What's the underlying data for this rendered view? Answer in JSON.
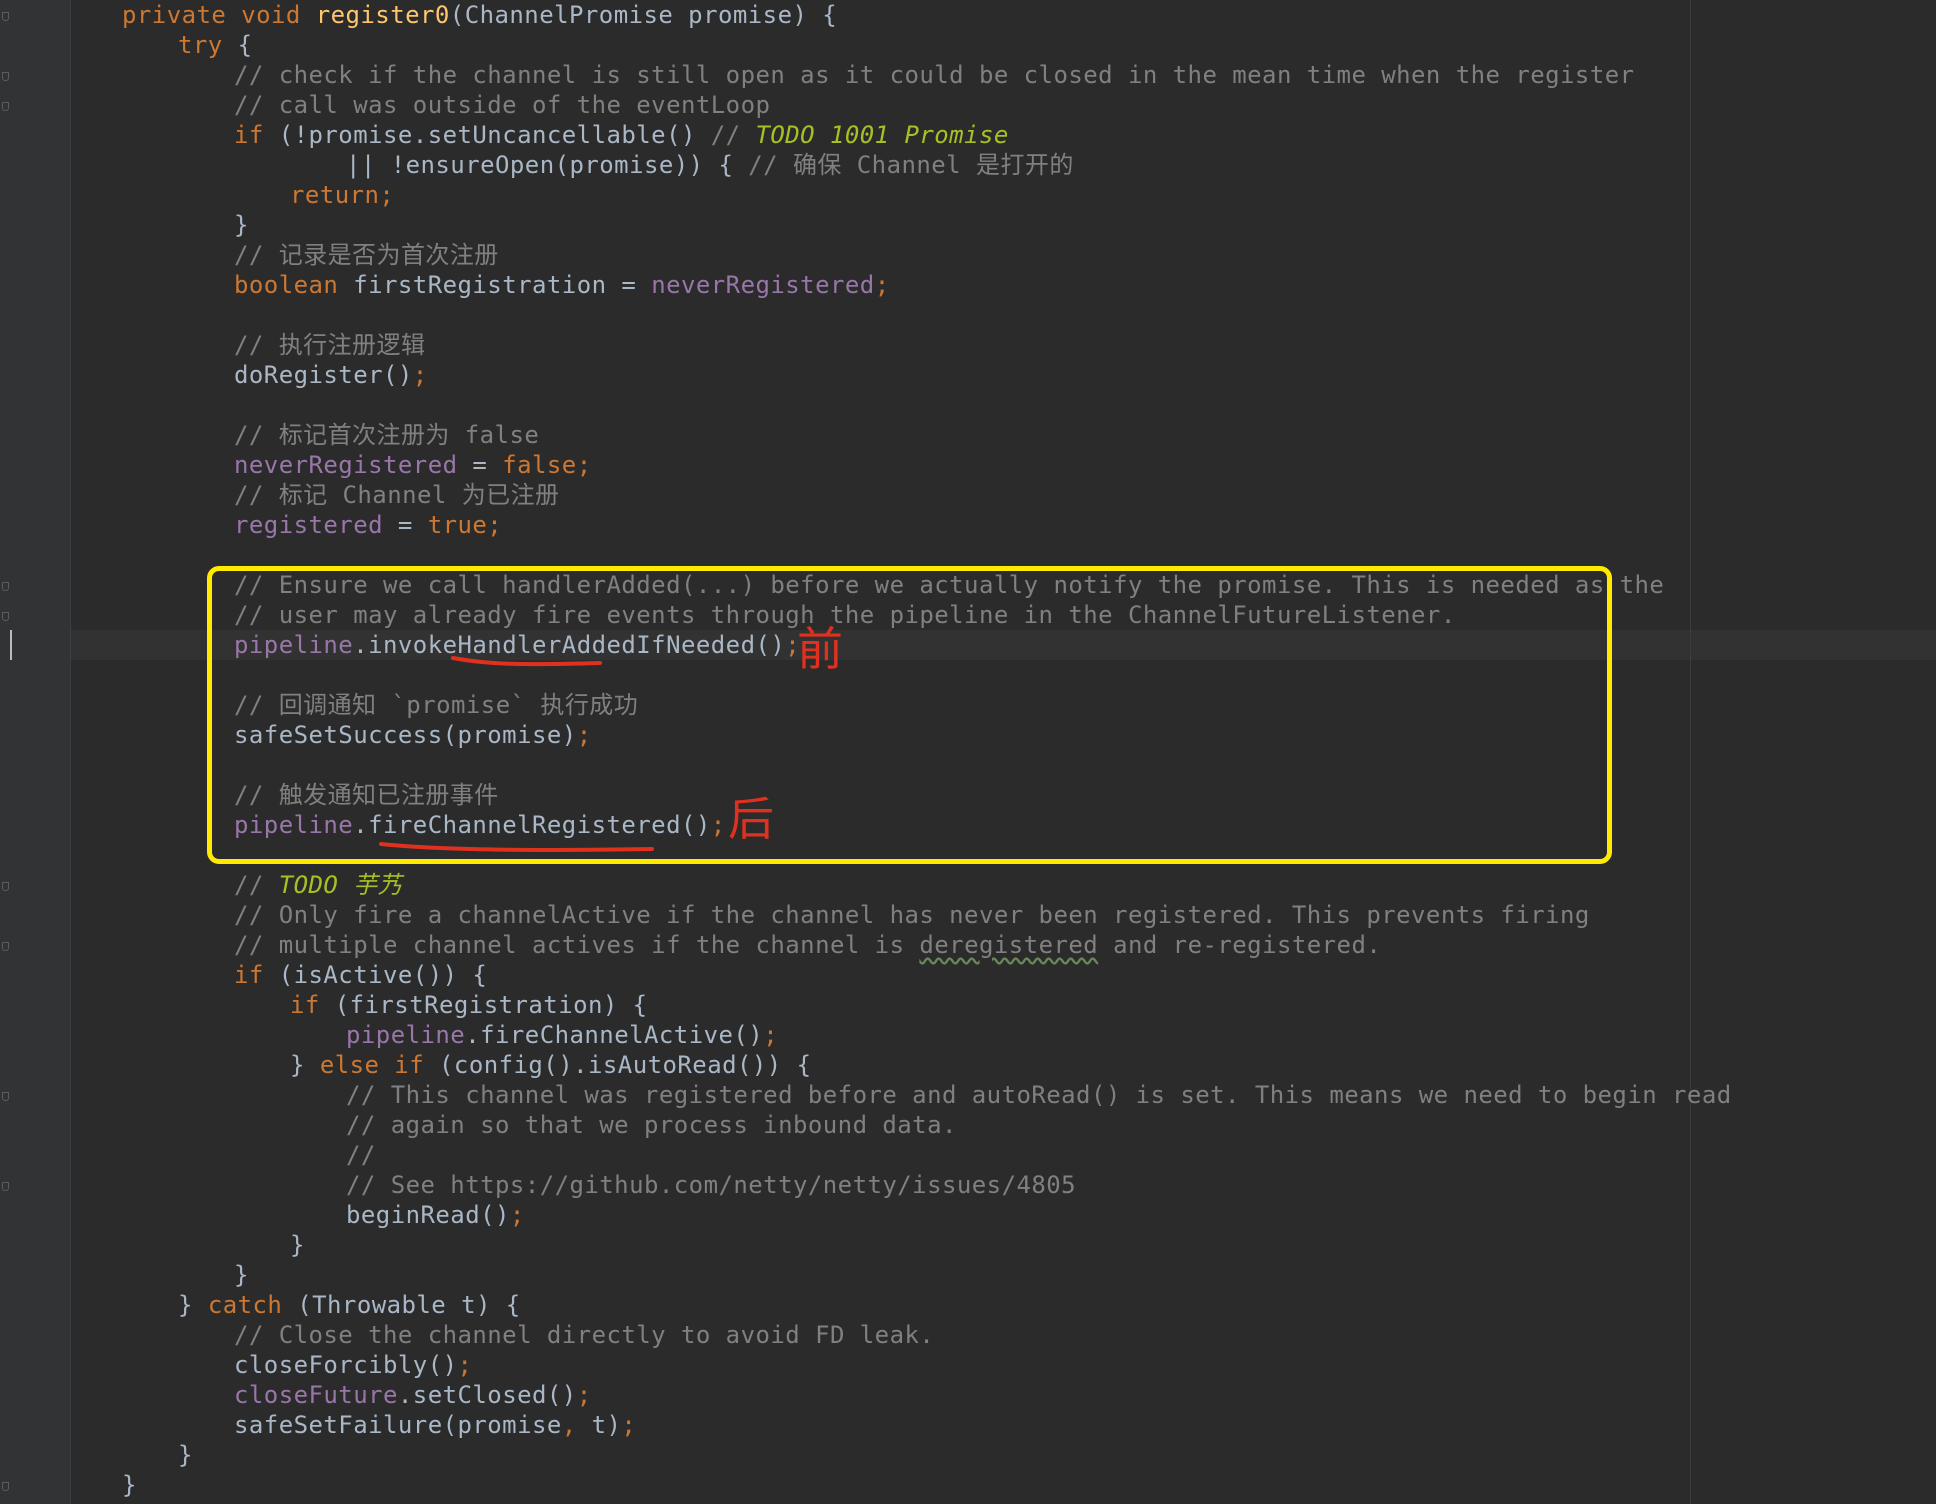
{
  "editor": {
    "colors": {
      "background": "#2b2b2b",
      "keyword": "#cc7832",
      "method_declaration": "#ffc66d",
      "field": "#9876aa",
      "comment": "#808080",
      "todo": "#a8c023",
      "plain": "#a9b7c6",
      "highlight_box": "#ffea00",
      "annotation_red": "#e0311f"
    },
    "lines": [
      {
        "n": 0,
        "indent": 1,
        "tokens": [
          {
            "t": "private ",
            "c": "kw"
          },
          {
            "t": "void ",
            "c": "kw"
          },
          {
            "t": "register0",
            "c": "fn"
          },
          {
            "t": "(ChannelPromise promise) {",
            "c": "pl"
          }
        ]
      },
      {
        "n": 1,
        "indent": 2,
        "tokens": [
          {
            "t": "try ",
            "c": "kw"
          },
          {
            "t": "{",
            "c": "pl"
          }
        ]
      },
      {
        "n": 2,
        "indent": 3,
        "tokens": [
          {
            "t": "// check if the channel is still open as it could be closed in the mean time when the register",
            "c": "cm"
          }
        ]
      },
      {
        "n": 3,
        "indent": 3,
        "tokens": [
          {
            "t": "// call was outside of the eventLoop",
            "c": "cm"
          }
        ]
      },
      {
        "n": 4,
        "indent": 3,
        "tokens": [
          {
            "t": "if ",
            "c": "kw"
          },
          {
            "t": "(!promise.setUncancellable() ",
            "c": "pl"
          },
          {
            "t": "// ",
            "c": "cm"
          },
          {
            "t": "TODO 1001 Promise",
            "c": "todo"
          }
        ]
      },
      {
        "n": 5,
        "indent": 5,
        "tokens": [
          {
            "t": "|| !ensureOpen(promise)) { ",
            "c": "pl"
          },
          {
            "t": "// 确保 Channel 是打开的",
            "c": "cm"
          }
        ]
      },
      {
        "n": 6,
        "indent": 4,
        "tokens": [
          {
            "t": "return;",
            "c": "kw"
          }
        ]
      },
      {
        "n": 7,
        "indent": 3,
        "tokens": [
          {
            "t": "}",
            "c": "pl"
          }
        ]
      },
      {
        "n": 8,
        "indent": 3,
        "tokens": [
          {
            "t": "// 记录是否为首次注册",
            "c": "cm"
          }
        ]
      },
      {
        "n": 9,
        "indent": 3,
        "tokens": [
          {
            "t": "boolean ",
            "c": "kw"
          },
          {
            "t": "firstRegistration = ",
            "c": "pl"
          },
          {
            "t": "neverRegistered",
            "c": "fld"
          },
          {
            "t": ";",
            "c": "kw"
          }
        ]
      },
      {
        "n": 11,
        "indent": 3,
        "tokens": [
          {
            "t": "// 执行注册逻辑",
            "c": "cm"
          }
        ]
      },
      {
        "n": 12,
        "indent": 3,
        "tokens": [
          {
            "t": "doRegister()",
            "c": "pl"
          },
          {
            "t": ";",
            "c": "kw"
          }
        ]
      },
      {
        "n": 14,
        "indent": 3,
        "tokens": [
          {
            "t": "// 标记首次注册为 false",
            "c": "cm"
          }
        ]
      },
      {
        "n": 15,
        "indent": 3,
        "tokens": [
          {
            "t": "neverRegistered",
            "c": "fld"
          },
          {
            "t": " = ",
            "c": "pl"
          },
          {
            "t": "false;",
            "c": "kw"
          }
        ]
      },
      {
        "n": 16,
        "indent": 3,
        "tokens": [
          {
            "t": "// 标记 Channel 为已注册",
            "c": "cm"
          }
        ]
      },
      {
        "n": 17,
        "indent": 3,
        "tokens": [
          {
            "t": "registered",
            "c": "fld"
          },
          {
            "t": " = ",
            "c": "pl"
          },
          {
            "t": "true;",
            "c": "kw"
          }
        ]
      },
      {
        "n": 19,
        "indent": 3,
        "tokens": [
          {
            "t": "// Ensure we call handlerAdded(...) before we actually notify the promise. This is needed as the",
            "c": "cm"
          }
        ]
      },
      {
        "n": 20,
        "indent": 3,
        "tokens": [
          {
            "t": "// user may already fire events through the pipeline in the ChannelFutureListener.",
            "c": "cm"
          }
        ]
      },
      {
        "n": 21,
        "indent": 3,
        "tokens": [
          {
            "t": "pipeline",
            "c": "fld"
          },
          {
            "t": ".invokeHandlerAddedIfNeeded()",
            "c": "pl"
          },
          {
            "t": ";",
            "c": "kw"
          }
        ]
      },
      {
        "n": 23,
        "indent": 3,
        "tokens": [
          {
            "t": "// 回调通知 `promise` 执行成功",
            "c": "cm"
          }
        ]
      },
      {
        "n": 24,
        "indent": 3,
        "tokens": [
          {
            "t": "safeSetSuccess(promise)",
            "c": "pl"
          },
          {
            "t": ";",
            "c": "kw"
          }
        ]
      },
      {
        "n": 26,
        "indent": 3,
        "tokens": [
          {
            "t": "// 触发通知已注册事件",
            "c": "cm"
          }
        ]
      },
      {
        "n": 27,
        "indent": 3,
        "tokens": [
          {
            "t": "pipeline",
            "c": "fld"
          },
          {
            "t": ".fireChannelRegistered()",
            "c": "pl"
          },
          {
            "t": ";",
            "c": "kw"
          }
        ]
      },
      {
        "n": 29,
        "indent": 3,
        "tokens": [
          {
            "t": "// ",
            "c": "cm"
          },
          {
            "t": "TODO 芋艿",
            "c": "todo"
          }
        ]
      },
      {
        "n": 30,
        "indent": 3,
        "tokens": [
          {
            "t": "// Only fire a channelActive if the channel has never been registered. This prevents firing",
            "c": "cm"
          }
        ]
      },
      {
        "n": 31,
        "indent": 3,
        "tokens": [
          {
            "t": "// multiple channel actives if the channel is ",
            "c": "cm"
          },
          {
            "t": "deregistered",
            "c": "cm wavy"
          },
          {
            "t": " and re-registered.",
            "c": "cm"
          }
        ]
      },
      {
        "n": 32,
        "indent": 3,
        "tokens": [
          {
            "t": "if ",
            "c": "kw"
          },
          {
            "t": "(isActive()) {",
            "c": "pl"
          }
        ]
      },
      {
        "n": 33,
        "indent": 4,
        "tokens": [
          {
            "t": "if ",
            "c": "kw"
          },
          {
            "t": "(firstRegistration) {",
            "c": "pl"
          }
        ]
      },
      {
        "n": 34,
        "indent": 5,
        "tokens": [
          {
            "t": "pipeline",
            "c": "fld"
          },
          {
            "t": ".fireChannelActive()",
            "c": "pl"
          },
          {
            "t": ";",
            "c": "kw"
          }
        ]
      },
      {
        "n": 35,
        "indent": 4,
        "tokens": [
          {
            "t": "} ",
            "c": "pl"
          },
          {
            "t": "else if ",
            "c": "kw"
          },
          {
            "t": "(config().isAutoRead()) {",
            "c": "pl"
          }
        ]
      },
      {
        "n": 36,
        "indent": 5,
        "tokens": [
          {
            "t": "// This channel was registered before and autoRead() is set. This means we need to begin read",
            "c": "cm"
          }
        ]
      },
      {
        "n": 37,
        "indent": 5,
        "tokens": [
          {
            "t": "// again so that we process inbound data.",
            "c": "cm"
          }
        ]
      },
      {
        "n": 38,
        "indent": 5,
        "tokens": [
          {
            "t": "//",
            "c": "cm"
          }
        ]
      },
      {
        "n": 39,
        "indent": 5,
        "tokens": [
          {
            "t": "// See https://github.com/netty/netty/issues/4805",
            "c": "cm"
          }
        ]
      },
      {
        "n": 40,
        "indent": 5,
        "tokens": [
          {
            "t": "beginRead()",
            "c": "pl"
          },
          {
            "t": ";",
            "c": "kw"
          }
        ]
      },
      {
        "n": 41,
        "indent": 4,
        "tokens": [
          {
            "t": "}",
            "c": "pl"
          }
        ]
      },
      {
        "n": 42,
        "indent": 3,
        "tokens": [
          {
            "t": "}",
            "c": "pl"
          }
        ]
      },
      {
        "n": 43,
        "indent": 2,
        "tokens": [
          {
            "t": "} ",
            "c": "pl"
          },
          {
            "t": "catch ",
            "c": "kw"
          },
          {
            "t": "(Throwable t) {",
            "c": "pl"
          }
        ]
      },
      {
        "n": 44,
        "indent": 3,
        "tokens": [
          {
            "t": "// Close the channel directly to avoid FD leak.",
            "c": "cm"
          }
        ]
      },
      {
        "n": 45,
        "indent": 3,
        "tokens": [
          {
            "t": "closeForcibly()",
            "c": "pl"
          },
          {
            "t": ";",
            "c": "kw"
          }
        ]
      },
      {
        "n": 46,
        "indent": 3,
        "tokens": [
          {
            "t": "closeFuture",
            "c": "fld"
          },
          {
            "t": ".setClosed()",
            "c": "pl"
          },
          {
            "t": ";",
            "c": "kw"
          }
        ]
      },
      {
        "n": 47,
        "indent": 3,
        "tokens": [
          {
            "t": "safeSetFailure(promise",
            "c": "pl"
          },
          {
            "t": ", ",
            "c": "kw"
          },
          {
            "t": "t)",
            "c": "pl"
          },
          {
            "t": ";",
            "c": "kw"
          }
        ]
      },
      {
        "n": 48,
        "indent": 2,
        "tokens": [
          {
            "t": "}",
            "c": "pl"
          }
        ]
      },
      {
        "n": 49,
        "indent": 1,
        "tokens": [
          {
            "t": "}",
            "c": "pl"
          }
        ]
      }
    ]
  },
  "annotations": {
    "before_label": "前",
    "after_label": "后"
  }
}
